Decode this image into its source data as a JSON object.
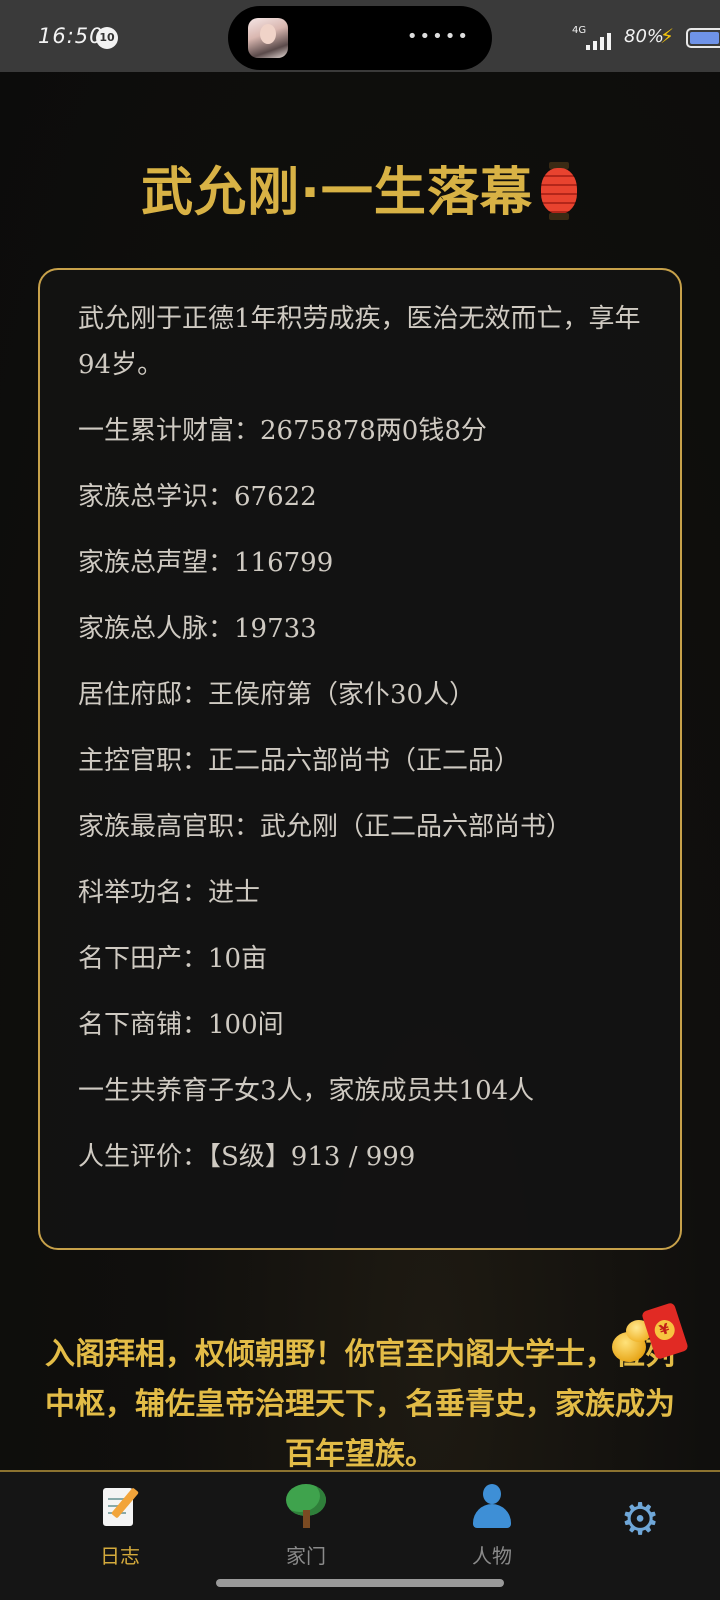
{
  "status_bar": {
    "time": "16:50",
    "notification_count": "10",
    "network": "4G",
    "battery_percent": "80%",
    "battery_level": 0.8,
    "signal_icon": "signal-icon",
    "charging_icon": "bolt-icon"
  },
  "title": {
    "text": "武允刚·一生落幕",
    "icon": "lantern-icon",
    "color": "#d8b245"
  },
  "summary": {
    "death_line": "武允刚于正德1年积劳成疾，医治无效而亡，享年94岁。",
    "lines": [
      "一生累计财富：2675878两0钱8分",
      "家族总学识：67622",
      "家族总声望：116799",
      "家族总人脉：19733",
      "居住府邸：王侯府第（家仆30人）",
      "主控官职：正二品六部尚书（正二品）",
      "家族最高官职：武允刚（正二品六部尚书）",
      "科举功名：进士",
      "名下田产：10亩",
      "名下商铺：100间",
      "一生共养育子女3人，家族成员共104人",
      "人生评价：【S级】913 / 999"
    ]
  },
  "ending": {
    "text": "入阁拜相，权倾朝野！你官至内阁大学士，位列中枢，辅佐皇帝治理天下，名垂青史，家族成为百年望族。",
    "icon": "red-packet-icon"
  },
  "nav": {
    "tabs": [
      {
        "label": "日志",
        "icon": "memo-icon",
        "active": true
      },
      {
        "label": "家门",
        "icon": "tree-icon",
        "active": false
      },
      {
        "label": "人物",
        "icon": "person-icon",
        "active": false
      }
    ],
    "settings_icon": "gear-icon"
  },
  "colors": {
    "accent_gold": "#d8b245",
    "card_border": "#c7a14a",
    "text": "#cfcac2"
  }
}
